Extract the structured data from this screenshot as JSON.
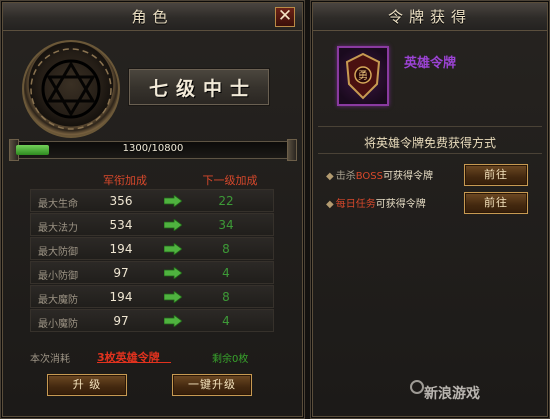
{
  "character_panel": {
    "title": "角色",
    "rank": "七级中士",
    "xp": {
      "text": "1300/10800",
      "progress": 0.12
    },
    "headers": {
      "current": "军衔加成",
      "next": "下一级加成"
    },
    "stats": [
      {
        "label": "最大生命",
        "current": "356",
        "next": "22"
      },
      {
        "label": "最大法力",
        "current": "534",
        "next": "34"
      },
      {
        "label": "最大防御",
        "current": "194",
        "next": "8"
      },
      {
        "label": "最小防御",
        "current": "97",
        "next": "4"
      },
      {
        "label": "最大魔防",
        "current": "194",
        "next": "8"
      },
      {
        "label": "最小魔防",
        "current": "97",
        "next": "4"
      }
    ],
    "cost": {
      "label": "本次消耗",
      "item": "3枚英雄令牌",
      "remaining": "剩余0枚"
    },
    "buttons": {
      "upgrade": "升 级",
      "one_click_upgrade": "一键升级"
    }
  },
  "token_panel": {
    "title": "令牌获得",
    "item_name": "英雄令牌",
    "section_title": "将英雄令牌免费获得方式",
    "sources": [
      {
        "bullet": "◆",
        "prefix": "击杀",
        "highlight": "BOSS",
        "suffix": "可获得令牌",
        "button": "前往"
      },
      {
        "bullet": "◆",
        "prefix": "",
        "highlight": "每日任务",
        "suffix": "可获得令牌",
        "button": "前往"
      }
    ]
  },
  "watermark": "新浪游戏",
  "colors": {
    "stat_next_green": "#3d9a37",
    "header_red": "#d8482b",
    "cost_red": "#e2321e",
    "item_purple": "#9b43d4",
    "xp_green": "#4caf3a"
  },
  "icons": [
    "close-icon",
    "hexagram-emblem-icon",
    "green-arrow-icon",
    "hero-token-icon",
    "diamond-bullet-icon"
  ]
}
